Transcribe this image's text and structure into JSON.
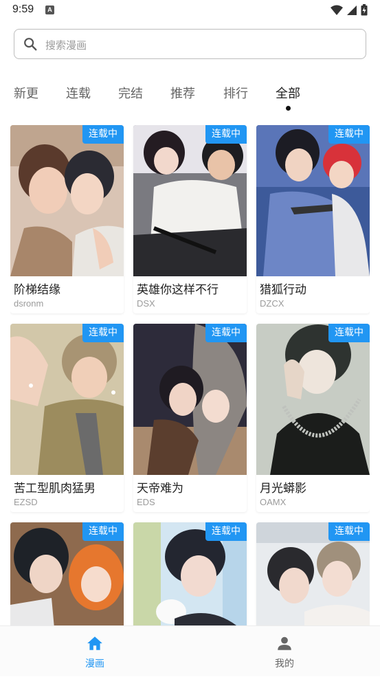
{
  "status_bar": {
    "time": "9:59",
    "notification_letter": "A"
  },
  "search": {
    "placeholder": "搜索漫画"
  },
  "tabs": [
    {
      "label": "新更",
      "active": false
    },
    {
      "label": "连载",
      "active": false
    },
    {
      "label": "完结",
      "active": false
    },
    {
      "label": "推荐",
      "active": false
    },
    {
      "label": "排行",
      "active": false
    },
    {
      "label": "全部",
      "active": true
    }
  ],
  "comics": [
    {
      "title": "阶梯结缘",
      "author": "dsronm",
      "badge": "连载中"
    },
    {
      "title": "英雄你这样不行",
      "author": "DSX",
      "badge": "连载中"
    },
    {
      "title": "猎狐行动",
      "author": "DZCX",
      "badge": "连载中"
    },
    {
      "title": "苦工型肌肉猛男",
      "author": "EZSD",
      "badge": "连载中"
    },
    {
      "title": "天帝难为",
      "author": "EDS",
      "badge": "连载中"
    },
    {
      "title": "月光蟒影",
      "author": "OAMX",
      "badge": "连载中"
    },
    {
      "title": "",
      "author": "",
      "badge": "连载中"
    },
    {
      "title": "",
      "author": "",
      "badge": "连载中"
    },
    {
      "title": "",
      "author": "",
      "badge": "连载中"
    }
  ],
  "bottom_nav": [
    {
      "label": "漫画",
      "icon": "home-icon",
      "active": true
    },
    {
      "label": "我的",
      "icon": "person-icon",
      "active": false
    }
  ],
  "colors": {
    "accent": "#2196f3",
    "badge_bg": "#2196f3",
    "inactive_nav": "#666666"
  }
}
